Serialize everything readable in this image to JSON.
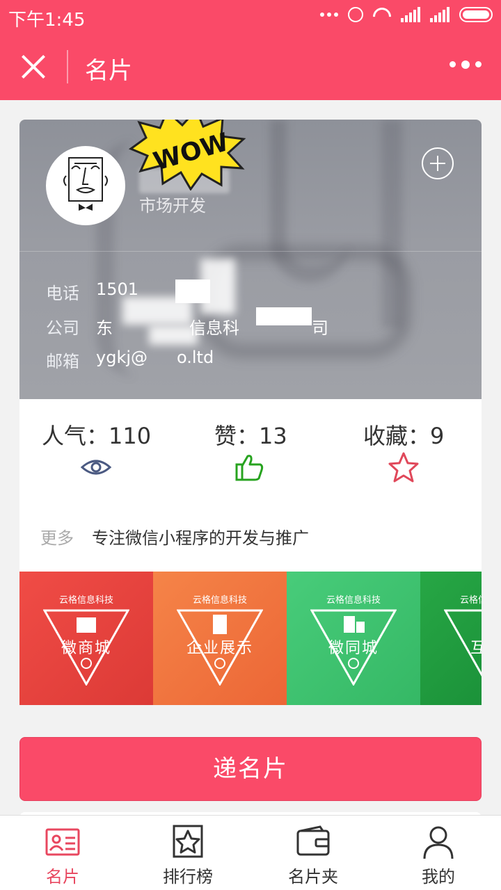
{
  "status_bar": {
    "time": "下午1:45"
  },
  "nav": {
    "title": "名片"
  },
  "card": {
    "position": "市场开发",
    "info": [
      {
        "label": "电话",
        "value": "1501"
      },
      {
        "label": "公司",
        "value": "东"
      },
      {
        "label": "邮箱",
        "value": "ygkj@"
      }
    ],
    "email_tail": "o.ltd",
    "company_mid": "信息科",
    "company_tail": "司"
  },
  "stats": [
    {
      "label": "人气：",
      "value": "110",
      "icon": "eye-icon",
      "color": "#4b5a82"
    },
    {
      "label": "赞：",
      "value": "13",
      "icon": "thumbs-up-icon",
      "color": "#27a31f"
    },
    {
      "label": "收藏：",
      "value": "9",
      "icon": "star-icon",
      "color": "#e0485a"
    }
  ],
  "more": {
    "label": "更多",
    "text": "专注微信小程序的开发与推广"
  },
  "tiles": [
    {
      "brand": "云格信息科技",
      "name": "微商城",
      "color": "#e84540"
    },
    {
      "brand": "云格信息科技",
      "name": "企业展示",
      "color": "#f0733f"
    },
    {
      "brand": "云格信息科技",
      "name": "微同城",
      "color": "#3dc26e"
    },
    {
      "brand": "云格信息科技",
      "name": "互动",
      "color": "#1e9a3d"
    }
  ],
  "primary_button": "递名片",
  "tabbar": [
    {
      "label": "名片",
      "icon": "card-icon",
      "active": true
    },
    {
      "label": "排行榜",
      "icon": "ranking-star-icon",
      "active": false
    },
    {
      "label": "名片夹",
      "icon": "wallet-icon",
      "active": false
    },
    {
      "label": "我的",
      "icon": "user-icon",
      "active": false
    }
  ],
  "colors": {
    "brand": "#fa4a68",
    "active_tab": "#e8475f"
  }
}
